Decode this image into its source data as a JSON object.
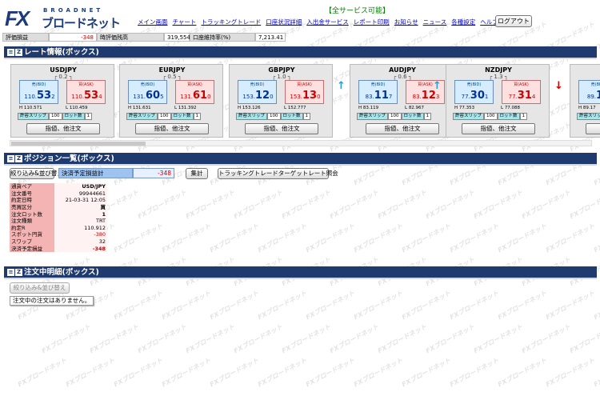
{
  "header": {
    "logo_fx": "FX",
    "logo_sub": "BROADNET",
    "logo_name": "ブロードネット",
    "status": "【全サービス可能】",
    "logout": "ログアウト"
  },
  "nav": [
    "メイン画面",
    "チャート",
    "トラッキングトレード",
    "口座状況詳細",
    "入出金サービス",
    "レポート印刷",
    "お知らせ",
    "ニュース",
    "各種設定",
    "ヘルプ"
  ],
  "summary": {
    "eval_label": "評価損益",
    "eval_value": "-348",
    "balance_label": "時評価残高",
    "balance_value": "319,554",
    "margin_label": "口座維持率(%)",
    "margin_value": "7,213.41"
  },
  "sections": {
    "rates": "レート情報(ボックス)",
    "positions": "ポジション一覧(ボックス)",
    "orders": "注文中明細(ボックス)",
    "icon_menu": "≡",
    "icon_z": "Z"
  },
  "rate_common": {
    "bid_label": "売(BID)",
    "ask_label": "買(ASK)",
    "slip_label": "許容スリップ",
    "slip_value": "100",
    "lot_label": "ロット数",
    "lot_value": "1",
    "order_button": "指値、他注文"
  },
  "rates": [
    {
      "pair": "USDJPY",
      "spread": "0.2",
      "bid_small": "110.",
      "bid_big": "53",
      "bid_pip": "2",
      "ask_small": "110.",
      "ask_big": "53",
      "ask_pip": "4",
      "high": "H 110.571",
      "low": "L 110.459",
      "arrow": ""
    },
    {
      "pair": "EURJPY",
      "spread": "0.5",
      "bid_small": "131.",
      "bid_big": "60",
      "bid_pip": "5",
      "ask_small": "131.",
      "ask_big": "61",
      "ask_pip": "0",
      "high": "H 131.631",
      "low": "L 131.392",
      "arrow": ""
    },
    {
      "pair": "GBPJPY",
      "spread": "1.0",
      "bid_small": "153.",
      "bid_big": "12",
      "bid_pip": "0",
      "ask_small": "153.",
      "ask_big": "13",
      "ask_pip": "0",
      "high": "H 153.126",
      "low": "L 152.777",
      "arrow": ""
    },
    {
      "pair": "AUDJPY",
      "spread": "0.6",
      "bid_small": "83.",
      "bid_big": "11",
      "bid_pip": "7",
      "ask_small": "83.",
      "ask_big": "12",
      "ask_pip": "3",
      "high": "H 83.119",
      "low": "L 82.967",
      "arrow": "↑"
    },
    {
      "pair": "NZDJPY",
      "spread": "1.3",
      "bid_small": "77.",
      "bid_big": "30",
      "bid_pip": "1",
      "ask_small": "77.",
      "ask_big": "31",
      "ask_pip": "4",
      "high": "H 77.353",
      "low": "L 77.088",
      "arrow": "↑"
    },
    {
      "pair": "C",
      "spread": "",
      "bid_small": "89.",
      "bid_big": "16",
      "bid_pip": "",
      "ask_small": "",
      "ask_big": "",
      "ask_pip": "",
      "high": "H 89.17",
      "low": "",
      "arrow": "↓"
    }
  ],
  "positions": {
    "filter_button": "絞り込み&並び替え",
    "pl_label": "決済予定損益計",
    "pl_value": "-348",
    "sum_button": "集計",
    "tracking_button": "トラッキングトレードターゲットレート照会",
    "rows": [
      {
        "k": "通貨ペア",
        "v": "USD/JPY"
      },
      {
        "k": "注文番号",
        "v": "99944661"
      },
      {
        "k": "約定日時",
        "v": "21-03-31 12:05"
      },
      {
        "k": "売買区分",
        "v": "買"
      },
      {
        "k": "注文ロット数",
        "v": "1"
      },
      {
        "k": "注文種類",
        "v": "TRT"
      },
      {
        "k": "約定R",
        "v": "110.912"
      },
      {
        "k": "スポット円貨",
        "v": "-380"
      },
      {
        "k": "スワップ",
        "v": "32"
      },
      {
        "k": "決済予定損益",
        "v": "-348"
      }
    ]
  },
  "orders": {
    "filter_button": "絞り込み&並び替え",
    "empty_message": "注文中の注文はありません。"
  },
  "watermark": "FXブロードネット",
  "colors": {
    "header_bar": "#1e3a6e",
    "bid": "#003399",
    "ask": "#cc0000",
    "arrow_up": "#2a9ad8",
    "arrow_down": "#cc0000"
  }
}
